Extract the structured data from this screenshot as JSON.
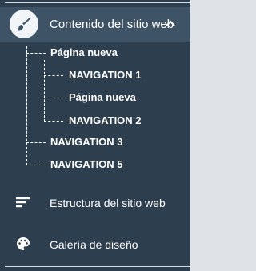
{
  "section": {
    "title": "Contenido del sitio web",
    "icon": "brush-icon",
    "expand_icon": "chevron-up-icon"
  },
  "tree": {
    "root": "Página nueva",
    "children": [
      "NAVIGATION 1",
      "Página nueva",
      "NAVIGATION 2"
    ],
    "siblings": [
      "NAVIGATION 3",
      "NAVIGATION 5"
    ]
  },
  "menu": {
    "structure": {
      "label": "Estructura del sitio web",
      "icon": "structure-icon"
    },
    "gallery": {
      "label": "Galería de diseño",
      "icon": "palette-icon"
    }
  },
  "colors": {
    "panel": "#2d3e4f",
    "header": "#3f5366",
    "text": "#ffffff"
  }
}
